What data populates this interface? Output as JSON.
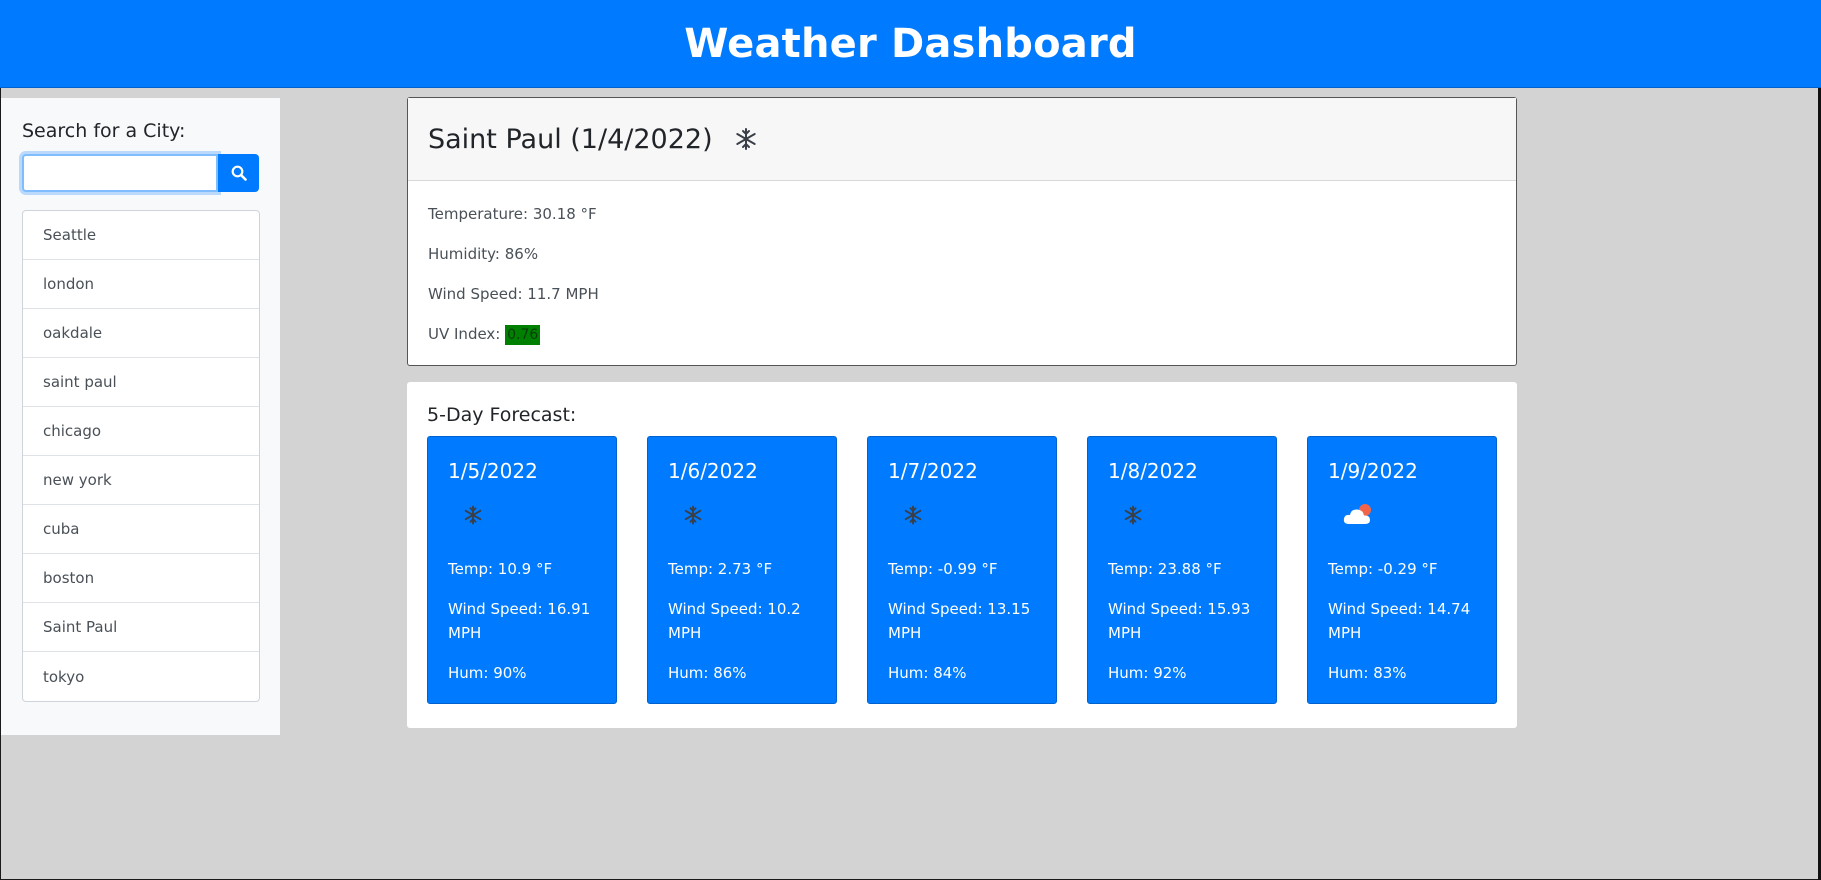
{
  "header": {
    "title": "Weather Dashboard"
  },
  "sidebar": {
    "heading": "Search for a City:",
    "search": {
      "value": "",
      "placeholder": ""
    },
    "history": [
      "Seattle",
      "london",
      "oakdale",
      "saint paul",
      "chicago",
      "new york",
      "cuba",
      "boston",
      "Saint Paul",
      "tokyo"
    ]
  },
  "current": {
    "title": "Saint Paul (1/4/2022)",
    "icon": "snowflake-icon",
    "temperature": "Temperature: 30.18 °F",
    "humidity": "Humidity: 86%",
    "wind": "Wind Speed: 11.7 MPH",
    "uv_label": "UV Index: ",
    "uv_value": "0.76",
    "uv_color": "#008000"
  },
  "forecast": {
    "heading": "5-Day Forecast:",
    "days": [
      {
        "date": "1/5/2022",
        "icon": "snowflake-icon",
        "temp": "Temp: 10.9 °F",
        "wind": "Wind Speed: 16.91 MPH",
        "hum": "Hum: 90%"
      },
      {
        "date": "1/6/2022",
        "icon": "snowflake-icon",
        "temp": "Temp: 2.73 °F",
        "wind": "Wind Speed: 10.2 MPH",
        "hum": "Hum: 86%"
      },
      {
        "date": "1/7/2022",
        "icon": "snowflake-icon",
        "temp": "Temp: -0.99 °F",
        "wind": "Wind Speed: 13.15 MPH",
        "hum": "Hum: 84%"
      },
      {
        "date": "1/8/2022",
        "icon": "snowflake-icon",
        "temp": "Temp: 23.88 °F",
        "wind": "Wind Speed: 15.93 MPH",
        "hum": "Hum: 92%"
      },
      {
        "date": "1/9/2022",
        "icon": "cloud-sun-icon",
        "temp": "Temp: -0.29 °F",
        "wind": "Wind Speed: 14.74 MPH",
        "hum": "Hum: 83%"
      }
    ]
  },
  "colors": {
    "primary": "#007bff",
    "background": "#d3d3d3",
    "sidebar": "#f8f9fa"
  }
}
